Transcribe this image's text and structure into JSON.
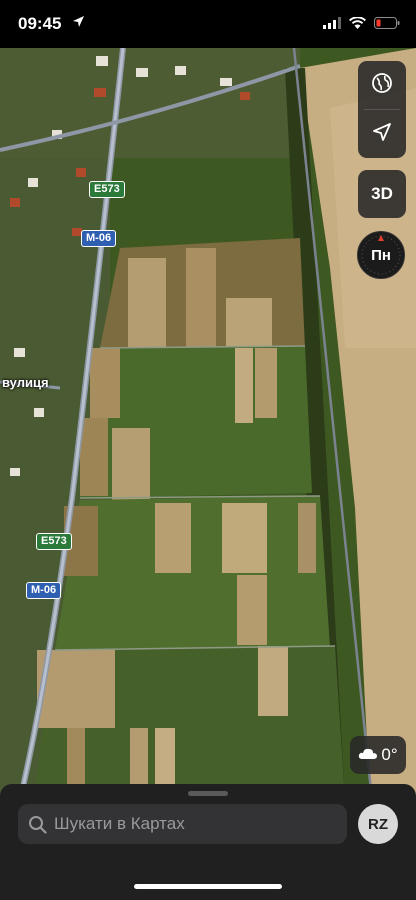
{
  "status": {
    "time": "09:45",
    "battery_color": "#ff3b30"
  },
  "map": {
    "road_labels": {
      "e573_top": "E573",
      "m06_top": "M-06",
      "e573_bottom": "E573",
      "m06_bottom": "M-06"
    },
    "street_label": "вулиця",
    "colors": {
      "road_green": "#2b7a3a",
      "road_blue": "#2f5fb0"
    }
  },
  "controls": {
    "three_d": "3D",
    "compass": "Пн",
    "temperature": "0°"
  },
  "search": {
    "placeholder": "Шукати в Картах",
    "avatar_initials": "RZ"
  }
}
